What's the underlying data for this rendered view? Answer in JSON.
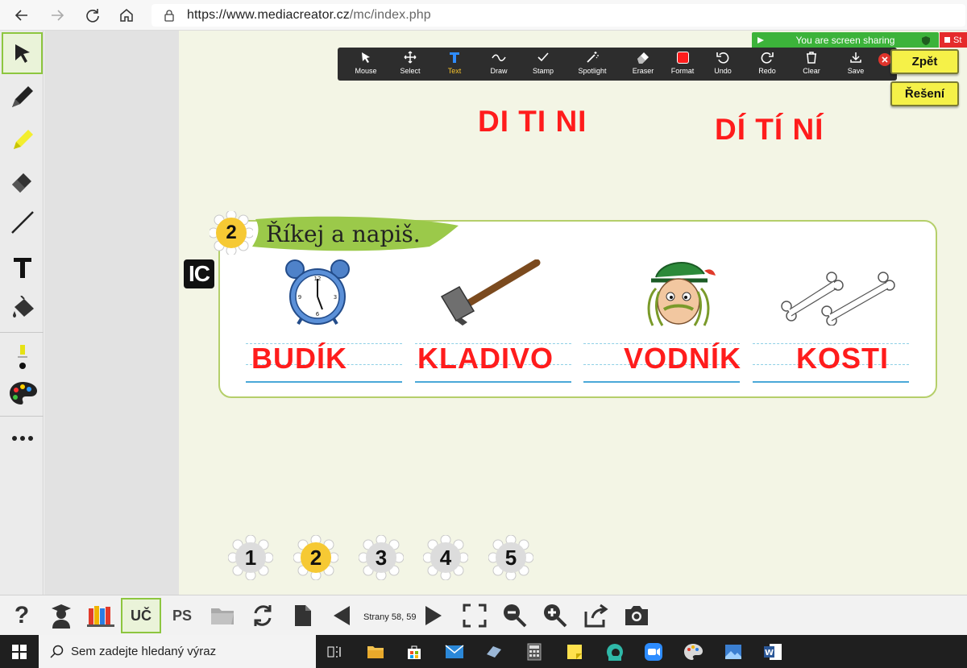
{
  "browser": {
    "url_host": "https://www.mediacreator.cz",
    "url_path": "/mc/index.php"
  },
  "zoom": {
    "sharing_text": "You are screen sharing",
    "stop_text": "St",
    "items": [
      {
        "label": "Mouse",
        "icon": "mouse-pointer-icon"
      },
      {
        "label": "Select",
        "icon": "move-icon"
      },
      {
        "label": "Text",
        "icon": "text-icon"
      },
      {
        "label": "Draw",
        "icon": "squiggle-icon"
      },
      {
        "label": "Stamp",
        "icon": "checkmark-icon"
      },
      {
        "label": "Spotlight",
        "icon": "magic-wand-icon"
      },
      {
        "label": "Eraser",
        "icon": "eraser-icon"
      },
      {
        "label": "Format",
        "icon": "color-square-icon"
      },
      {
        "label": "Undo",
        "icon": "undo-icon"
      },
      {
        "label": "Redo",
        "icon": "redo-icon"
      },
      {
        "label": "Clear",
        "icon": "trash-icon"
      },
      {
        "label": "Save",
        "icon": "download-icon"
      }
    ],
    "selected": "Text",
    "format_color": "#ff1c1c"
  },
  "buttons": {
    "back": "Zpět",
    "solution": "Řešení"
  },
  "annotations": {
    "short_syllables": "DI  TI  NI",
    "long_syllables": "DÍ   TÍ   NÍ"
  },
  "exercise": {
    "number": "2",
    "title": "Říkej a napiš.",
    "ic_badge": "IC",
    "words": [
      "BUDÍK",
      "KLADIVO",
      "VODNÍK",
      "KOSTI"
    ],
    "pictures": [
      "alarm-clock-icon",
      "hammer-icon",
      "water-goblin-icon",
      "bones-icon"
    ]
  },
  "pagination": {
    "pages": [
      "1",
      "2",
      "3",
      "4",
      "5"
    ],
    "current": "2"
  },
  "bottom": {
    "uc_label": "UČ",
    "ps_label": "PS",
    "pages_text": "Strany 58, 59",
    "help": "?"
  },
  "taskbar": {
    "search_placeholder": "Sem zadejte hledaný výraz"
  },
  "colors": {
    "accent_green": "#8dc63f",
    "annotation_red": "#ff1c1c",
    "button_yellow": "#f5f148",
    "canvas_bg": "#f3f5e5"
  }
}
